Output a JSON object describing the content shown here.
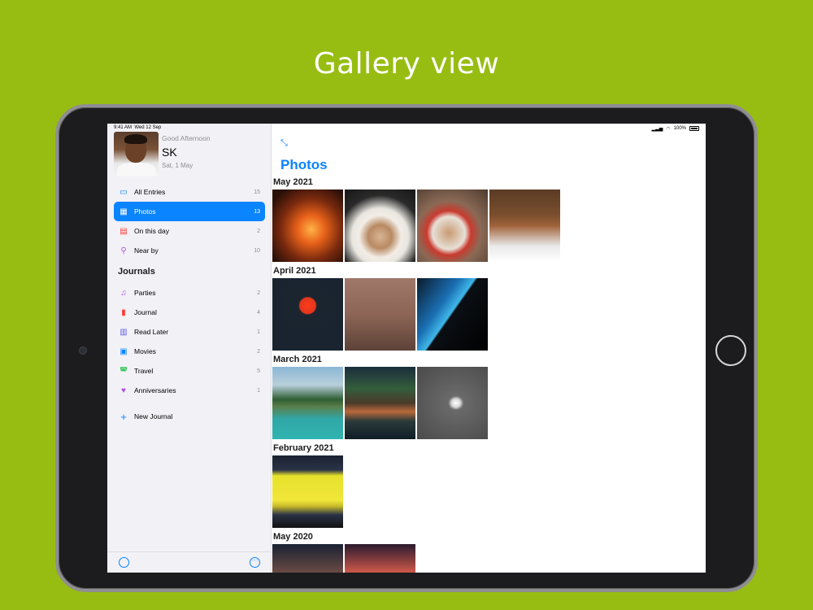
{
  "headline": "Gallery view",
  "status": {
    "time": "9:41 AM",
    "date": "Wed 12 Sep",
    "battery": "100%"
  },
  "profile": {
    "greeting": "Good Afternoon",
    "name": "SK",
    "date": "Sat, 1 May"
  },
  "nav": [
    {
      "label": "All Entries",
      "count": "15",
      "icon": "tray-icon",
      "color": "#0a84ff"
    },
    {
      "label": "Photos",
      "count": "13",
      "icon": "grid-icon",
      "color": "#ffffff",
      "active": true
    },
    {
      "label": "On this day",
      "count": "2",
      "icon": "calendar-icon",
      "color": "#ff3b30"
    },
    {
      "label": "Near by",
      "count": "10",
      "icon": "location-pin-icon",
      "color": "#af52de"
    }
  ],
  "journals": {
    "title": "Journals",
    "items": [
      {
        "label": "Parties",
        "count": "2",
        "icon": "music-notes-icon",
        "color": "#af52de"
      },
      {
        "label": "Journal",
        "count": "4",
        "icon": "bookmark-icon",
        "color": "#ff3b30"
      },
      {
        "label": "Read Later",
        "count": "1",
        "icon": "book-icon",
        "color": "#5e5ce6"
      },
      {
        "label": "Movies",
        "count": "2",
        "icon": "film-icon",
        "color": "#0a84ff"
      },
      {
        "label": "Travel",
        "count": "5",
        "icon": "car-icon",
        "color": "#34c759"
      },
      {
        "label": "Anniversaries",
        "count": "1",
        "icon": "heart-icon",
        "color": "#af52de"
      }
    ],
    "new_journal": "New Journal"
  },
  "main": {
    "title": "Photos",
    "sections": [
      {
        "label": "May 2021",
        "photos": [
          "fire",
          "coffee1",
          "coffee2",
          "portrait"
        ]
      },
      {
        "label": "April 2021",
        "photos": [
          "sunset",
          "mars",
          "abstract"
        ]
      },
      {
        "label": "March 2021",
        "photos": [
          "resort1",
          "resort2",
          "cloud"
        ]
      },
      {
        "label": "February 2021",
        "photos": [
          "box"
        ]
      },
      {
        "label": "May 2020",
        "photos": [
          "may2020a",
          "may2020b"
        ]
      }
    ]
  },
  "colors": {
    "background": "#97bd12",
    "accent": "#0a84ff",
    "sidebar": "#f1f1f6"
  }
}
